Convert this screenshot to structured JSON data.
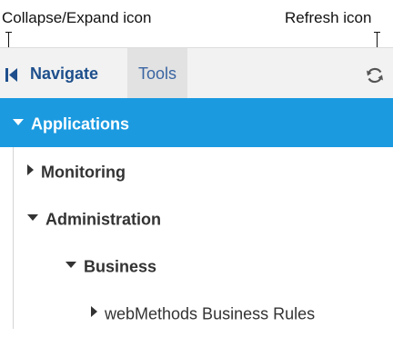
{
  "callouts": {
    "collapse_label": "Collapse/Expand icon",
    "refresh_label": "Refresh icon"
  },
  "toolbar": {
    "collapse_icon": "collapse-expand-icon",
    "tabs": [
      {
        "label": "Navigate",
        "active": true
      },
      {
        "label": "Tools",
        "active": false
      }
    ],
    "refresh_icon": "refresh-icon"
  },
  "tree": {
    "nodes": [
      {
        "label": "Applications",
        "expanded": true,
        "selected": true,
        "level": 0
      },
      {
        "label": "Monitoring",
        "expanded": false,
        "selected": false,
        "level": 1
      },
      {
        "label": "Administration",
        "expanded": true,
        "selected": false,
        "level": 1
      },
      {
        "label": "Business",
        "expanded": true,
        "selected": false,
        "level": 2
      },
      {
        "label": "webMethods Business Rules",
        "expanded": false,
        "selected": false,
        "level": 3
      }
    ]
  },
  "colors": {
    "selected_background": "#1b9ae0",
    "active_tab_text": "#1e4f8c",
    "inactive_tab_text": "#3a64a2",
    "toolbar_background": "#f2f2f2"
  }
}
